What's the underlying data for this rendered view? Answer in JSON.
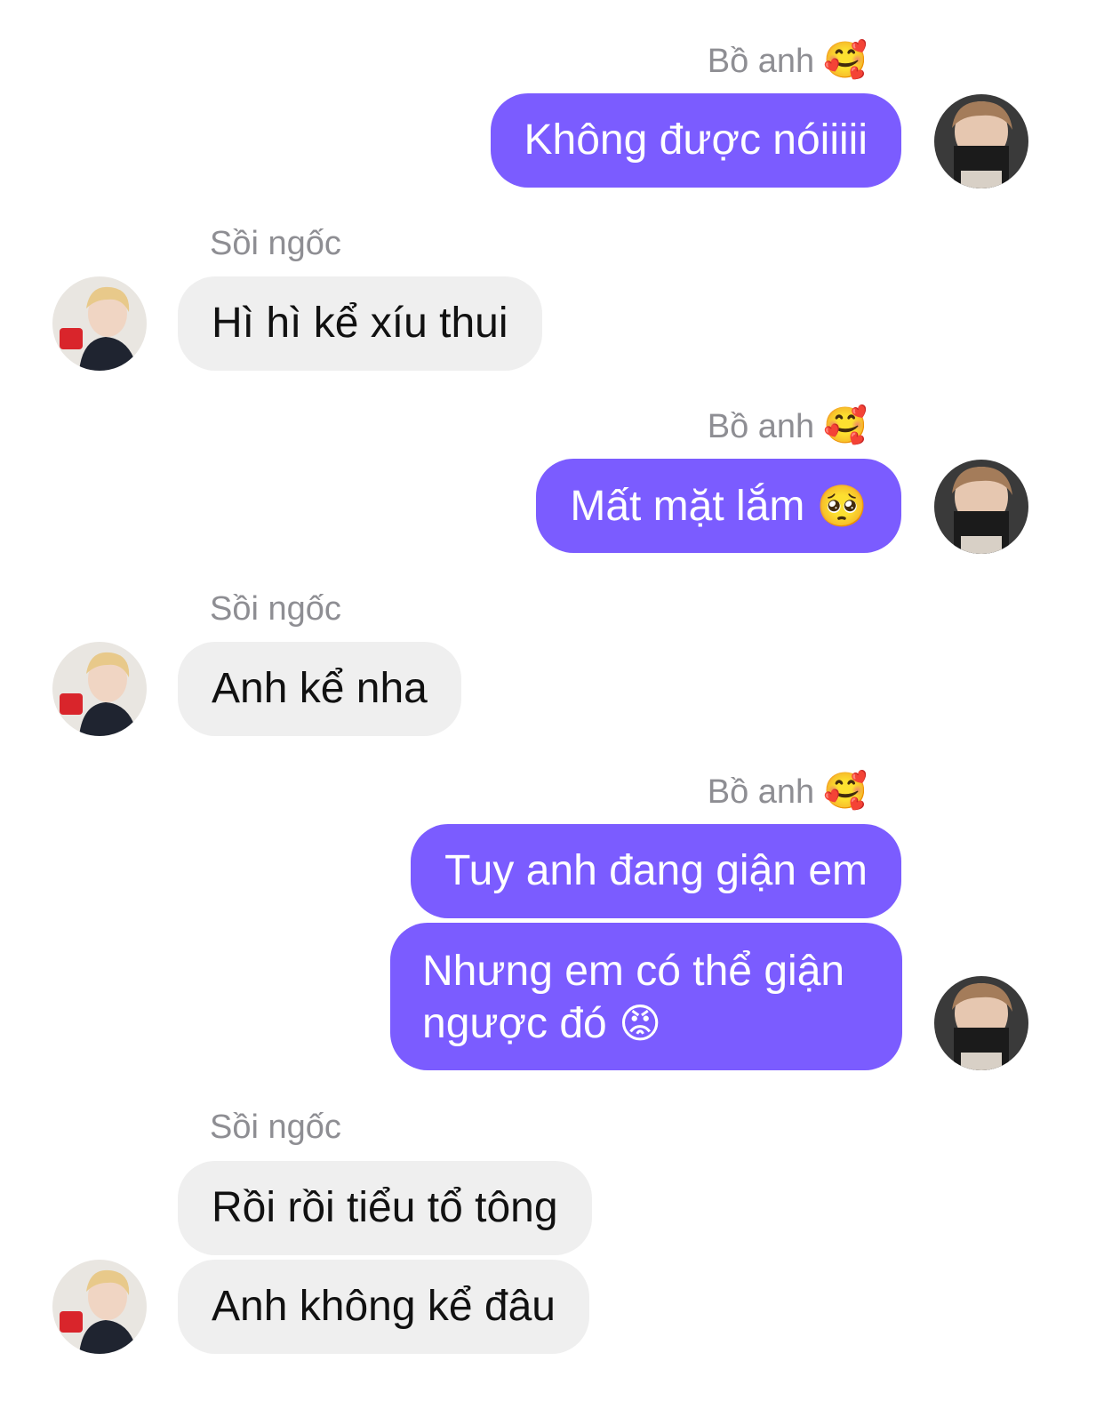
{
  "chat": {
    "messages": [
      {
        "sender": "Bồ anh",
        "sender_emoji": "🥰",
        "text": "Không được nóiiiii",
        "emoji": ""
      },
      {
        "sender": "Sồi ngốc",
        "text": "Hì hì kể xíu thui"
      },
      {
        "sender": "Bồ anh",
        "sender_emoji": "🥰",
        "text": "Mất mặt lắm",
        "emoji": "🥺"
      },
      {
        "sender": "Sồi ngốc",
        "text": "Anh kể nha"
      },
      {
        "sender": "Bồ anh",
        "sender_emoji": "🥰",
        "text": "Tuy anh đang giận em"
      },
      {
        "text": "Nhưng em có thể giận ngược đó",
        "emoji": "😡"
      },
      {
        "sender": "Sồi ngốc",
        "text": "Rồi rồi tiểu tổ tông"
      },
      {
        "text": "Anh không kể đâu"
      }
    ]
  },
  "colors": {
    "outgoing_bubble": "#7b5cff",
    "incoming_bubble": "#efefef",
    "sender_name": "#8e8e93"
  },
  "icons": {
    "outgoing_avatar": "avatar-photo-brown-hair",
    "incoming_avatar": "avatar-photo-blonde-hair"
  }
}
